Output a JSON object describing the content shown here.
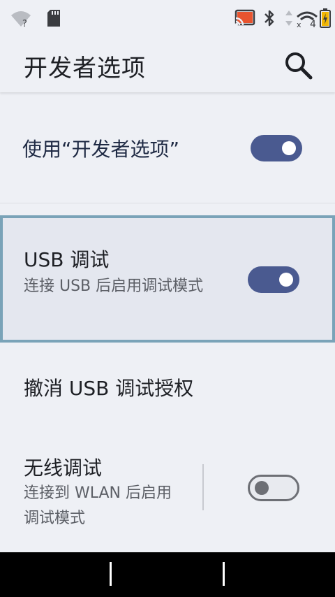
{
  "status_bar": {
    "icons": [
      "wifi-unknown-icon",
      "sd-card-icon",
      "cast-icon",
      "bluetooth-icon",
      "data-arrows-icon",
      "signal-icon",
      "battery-charging-icon"
    ],
    "wifi_badge": "?",
    "signal_badge": "4",
    "accent_cast": "#e8542f",
    "accent_battery": "#f2b705"
  },
  "app_bar": {
    "title": "开发者选项",
    "search_icon": "search-icon"
  },
  "settings": {
    "master": {
      "title": "使用“开发者选项”",
      "enabled": true
    },
    "usb_debugging": {
      "title": "USB 调试",
      "subtitle": "连接 USB 后启用调试模式",
      "enabled": true,
      "highlighted": true
    },
    "revoke": {
      "title": "撤消 USB 调试授权"
    },
    "wireless_debugging": {
      "title": "无线调试",
      "subtitle": "连接到 WLAN 后启用调试模式",
      "enabled": false
    }
  },
  "colors": {
    "toggle_on": "#4a5a90",
    "highlight_border": "#7aa3b8",
    "background": "#eef0f5"
  }
}
